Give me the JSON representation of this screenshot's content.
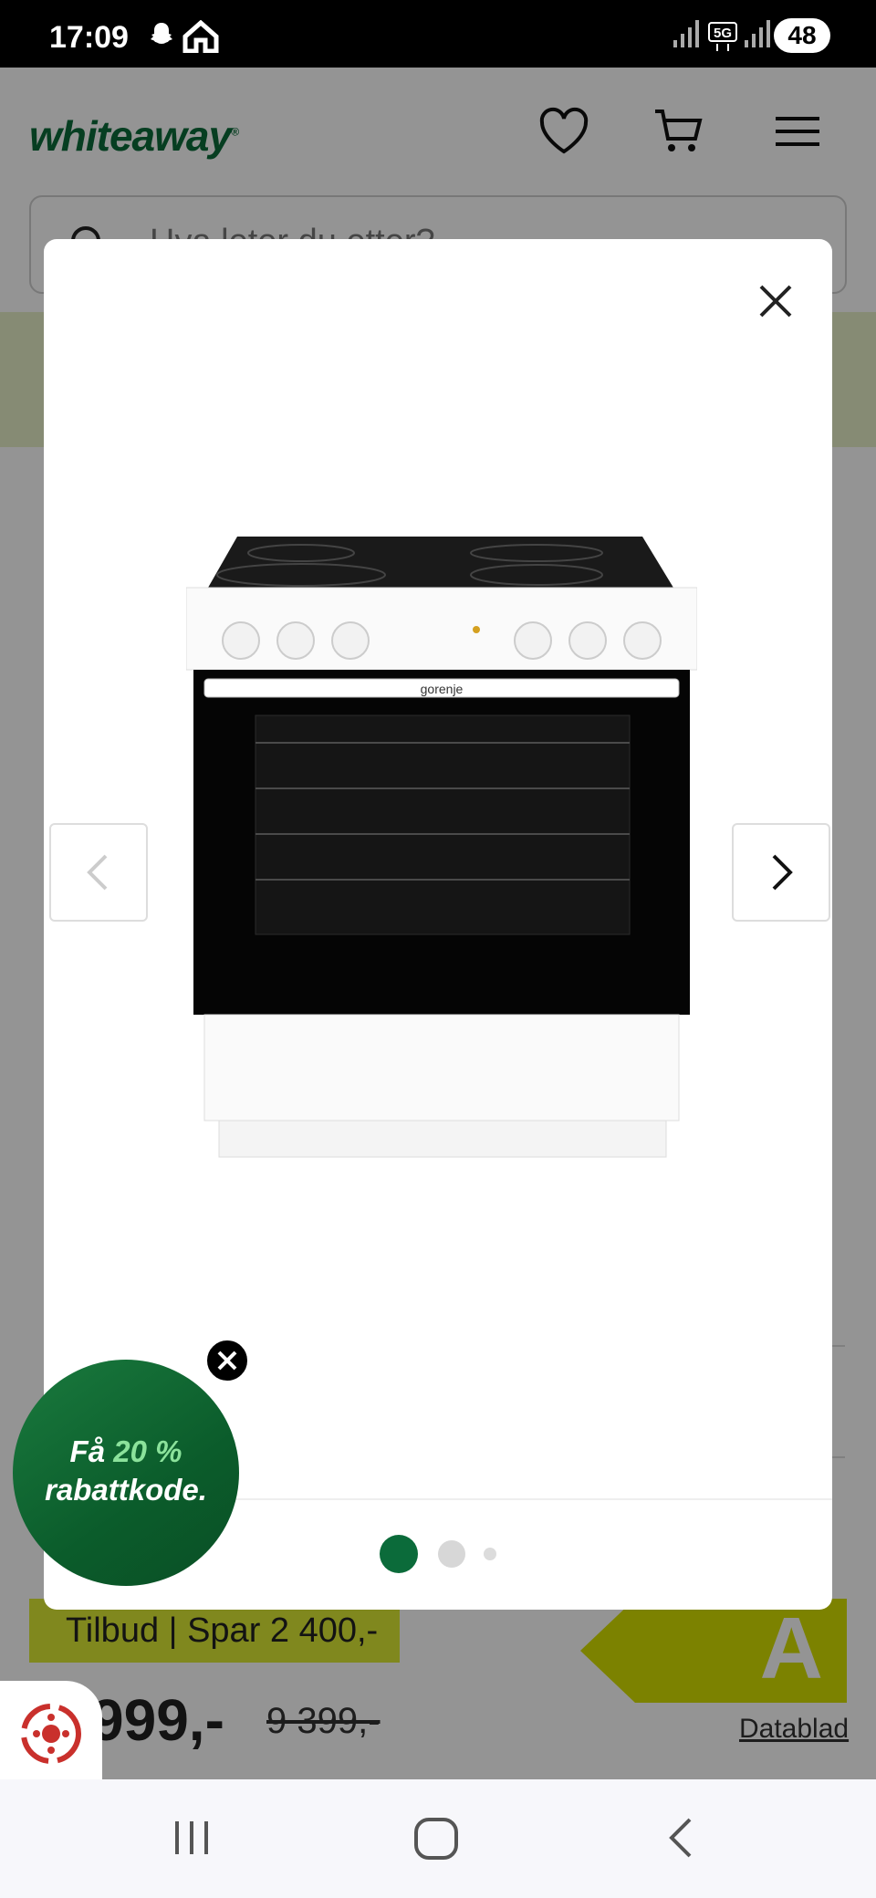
{
  "status_bar": {
    "time": "17:09",
    "battery": "48",
    "network": "5G",
    "icons": [
      "snapchat-icon",
      "home-icon",
      "signal-icon",
      "5g-icon",
      "signal-icon"
    ]
  },
  "header": {
    "logo": "whiteaway",
    "icons": [
      "heart-icon",
      "cart-icon",
      "menu-icon"
    ]
  },
  "search": {
    "placeholder": "Hva leter du etter?"
  },
  "product": {
    "offer_label": "Tilbud | Spar 2 400,-",
    "price": "999,-",
    "old_price": "9 399,-",
    "energy_class": "A",
    "datablad_label": "Datablad"
  },
  "gallery_modal": {
    "image_alt": "gorenje",
    "slide_count": 3,
    "active_slide": 1,
    "accent": "#0b6b3a"
  },
  "discount_bubble": {
    "prefix": "Få",
    "highlight": "20 %",
    "line2": "rabattkode."
  },
  "colors": {
    "brand_green": "#0b6b3a",
    "offer_yellow": "#ddea35",
    "energy_yellow": "#d6e000"
  }
}
